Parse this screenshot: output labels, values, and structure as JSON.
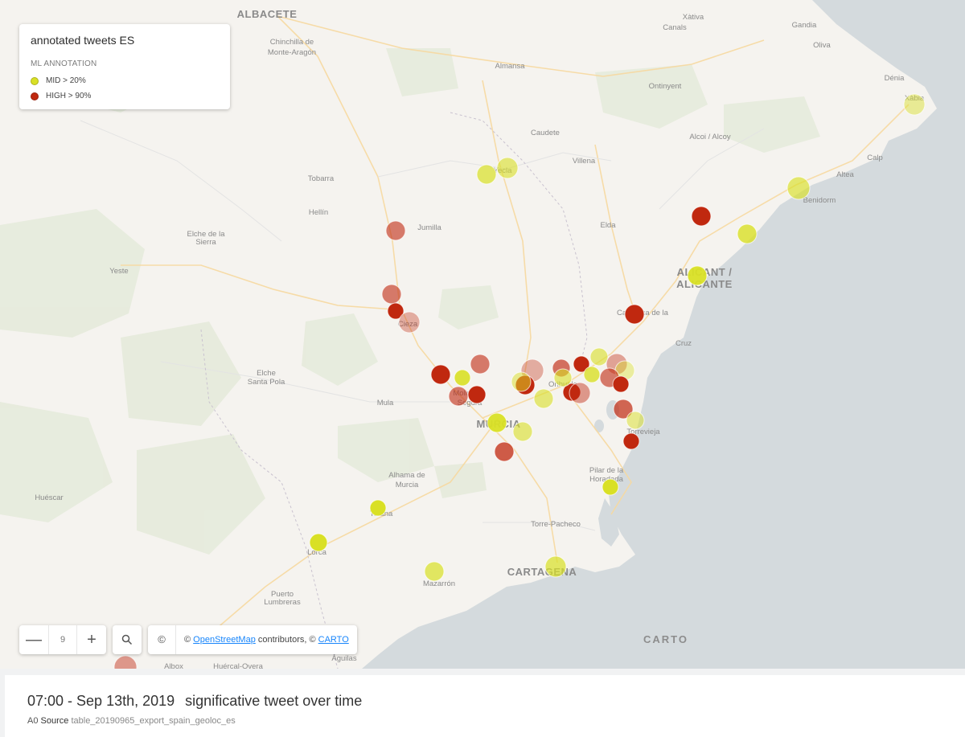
{
  "legend": {
    "title": "annotated tweets ES",
    "subtitle": "ML ANNOTATION",
    "items": [
      {
        "label": "MID > 20%",
        "color": "#d9e025"
      },
      {
        "label": "HIGH > 90%",
        "color": "#c0280f"
      }
    ]
  },
  "map_labels": [
    "ALBACETE",
    "Chinchilla de",
    "Monte-Aragón",
    "Almansa",
    "Xàtiva",
    "Canals",
    "Gandia",
    "Oliva",
    "Ontinyent",
    "Dénia",
    "Xàbia",
    "Caudete",
    "Alcoi / Alcoy",
    "Yecla",
    "Villena",
    "Calp",
    "Tobarra",
    "Altea",
    "Benidorm",
    "Hellín",
    "Jumilla",
    "Elda",
    "Elche de la",
    "Sierra",
    "Yeste",
    "ALICANT /",
    "ALICANTE",
    "Cieza",
    "Elche",
    "Santa Pola",
    "Caravaca de la",
    "Cruz",
    "Orihuela",
    "Mula",
    "Molina de",
    "Segura",
    "MURCIA",
    "Torrevieja",
    "Pilar de la",
    "Horadada",
    "Alhama de",
    "Murcia",
    "Huéscar",
    "Totana",
    "Torre-Pacheco",
    "Lorca",
    "CARTAGENA",
    "Mazarrón",
    "Puerto",
    "Lumbreras",
    "Albox",
    "Huércal-Overa",
    "Águilas"
  ],
  "controls": {
    "zoom_out": "—",
    "zoom_level": "9",
    "zoom_in": "+",
    "search_icon": "magnifier-icon",
    "copyright_symbol": "©",
    "attribution_prefix": "©",
    "osm_link": "OpenStreetMap",
    "attribution_mid": "contributors, ©",
    "carto_link": "CARTO"
  },
  "carto_logo": "CARTO",
  "footer": {
    "timestamp": "07:00 - Sep 13th, 2019",
    "title": "significative tweet over time",
    "source_code": "A0",
    "source_label": "Source",
    "source_table": "table_20190965_export_spain_geoloc_es"
  },
  "colors": {
    "land": "#f5f3ef",
    "sea": "#d4dadd",
    "mid": "#d9e025",
    "high": "#c0280f",
    "link": "#1785fb"
  }
}
